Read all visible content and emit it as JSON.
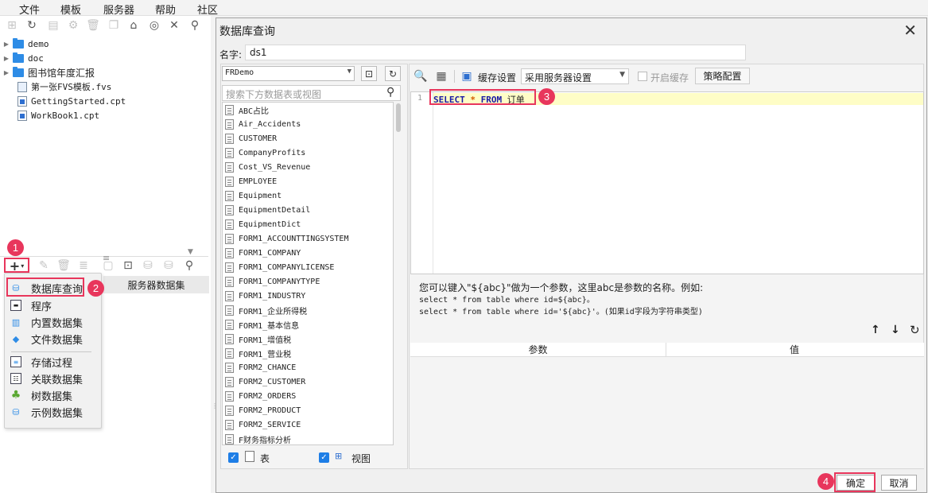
{
  "menubar": {
    "items": [
      "文件",
      "模板",
      "服务器",
      "帮助",
      "社区"
    ]
  },
  "file_tree": [
    {
      "name": "demo",
      "type": "folder"
    },
    {
      "name": "doc",
      "type": "folder"
    },
    {
      "name": "图书馆年度汇报",
      "type": "folder"
    },
    {
      "name": "第一张FVS模板.fvs",
      "type": "fvs"
    },
    {
      "name": "GettingStarted.cpt",
      "type": "cpt"
    },
    {
      "name": "WorkBook1.cpt",
      "type": "cpt"
    }
  ],
  "dataset_panel": {
    "add_glyph": "+",
    "header": "服务器数据集",
    "popup_items": [
      "数据库查询",
      "程序",
      "内置数据集",
      "文件数据集",
      "存储过程",
      "关联数据集",
      "树数据集",
      "示例数据集"
    ]
  },
  "dialog": {
    "title": "数据库查询",
    "name_label": "名字:",
    "name_value": "ds1",
    "connection": "FRDemo",
    "search_placeholder": "搜索下方数据表或视图",
    "tables": [
      "ABC占比",
      "Air_Accidents",
      "CUSTOMER",
      "CompanyProfits",
      "Cost_VS_Revenue",
      "EMPLOYEE",
      "Equipment",
      "EquipmentDetail",
      "EquipmentDict",
      "FORM1_ACCOUNTTINGSYSTEM",
      "FORM1_COMPANY",
      "FORM1_COMPANYLICENSE",
      "FORM1_COMPANYTYPE",
      "FORM1_INDUSTRY",
      "FORM1_企业所得税",
      "FORM1_基本信息",
      "FORM1_增值税",
      "FORM1_营业税",
      "FORM2_CHANCE",
      "FORM2_CUSTOMER",
      "FORM2_ORDERS",
      "FORM2_PRODUCT",
      "FORM2_SERVICE",
      "F财务指标分析"
    ],
    "table_check_label": "表",
    "view_check_label": "视图",
    "cache_label": "缓存设置",
    "cache_value": "采用服务器设置",
    "enable_cache_label": "开启缓存",
    "strategy_button": "策略配置",
    "sql": {
      "line_number": "1",
      "kw_select": "SELECT",
      "star": "*",
      "kw_from": "FROM",
      "table": "订单"
    },
    "help_lines": [
      "您可以键入\"${abc}\"做为一个参数，这里abc是参数的名称。例如:",
      "select * from table where id=${abc}。",
      "select * from table where id='${abc}'。(如果id字段为字符串类型)"
    ],
    "param_col": "参数",
    "value_col": "值",
    "ok_button": "确定",
    "cancel_button": "取消"
  },
  "callouts": [
    "1",
    "2",
    "3",
    "4"
  ],
  "colors": {
    "accent": "#e8365c",
    "check": "#1e7ee6",
    "folder": "#2e8ce6",
    "sql_keyword": "#1a1aa6",
    "sql_star": "#d45c00",
    "line_highlight": "#fefdc6"
  }
}
